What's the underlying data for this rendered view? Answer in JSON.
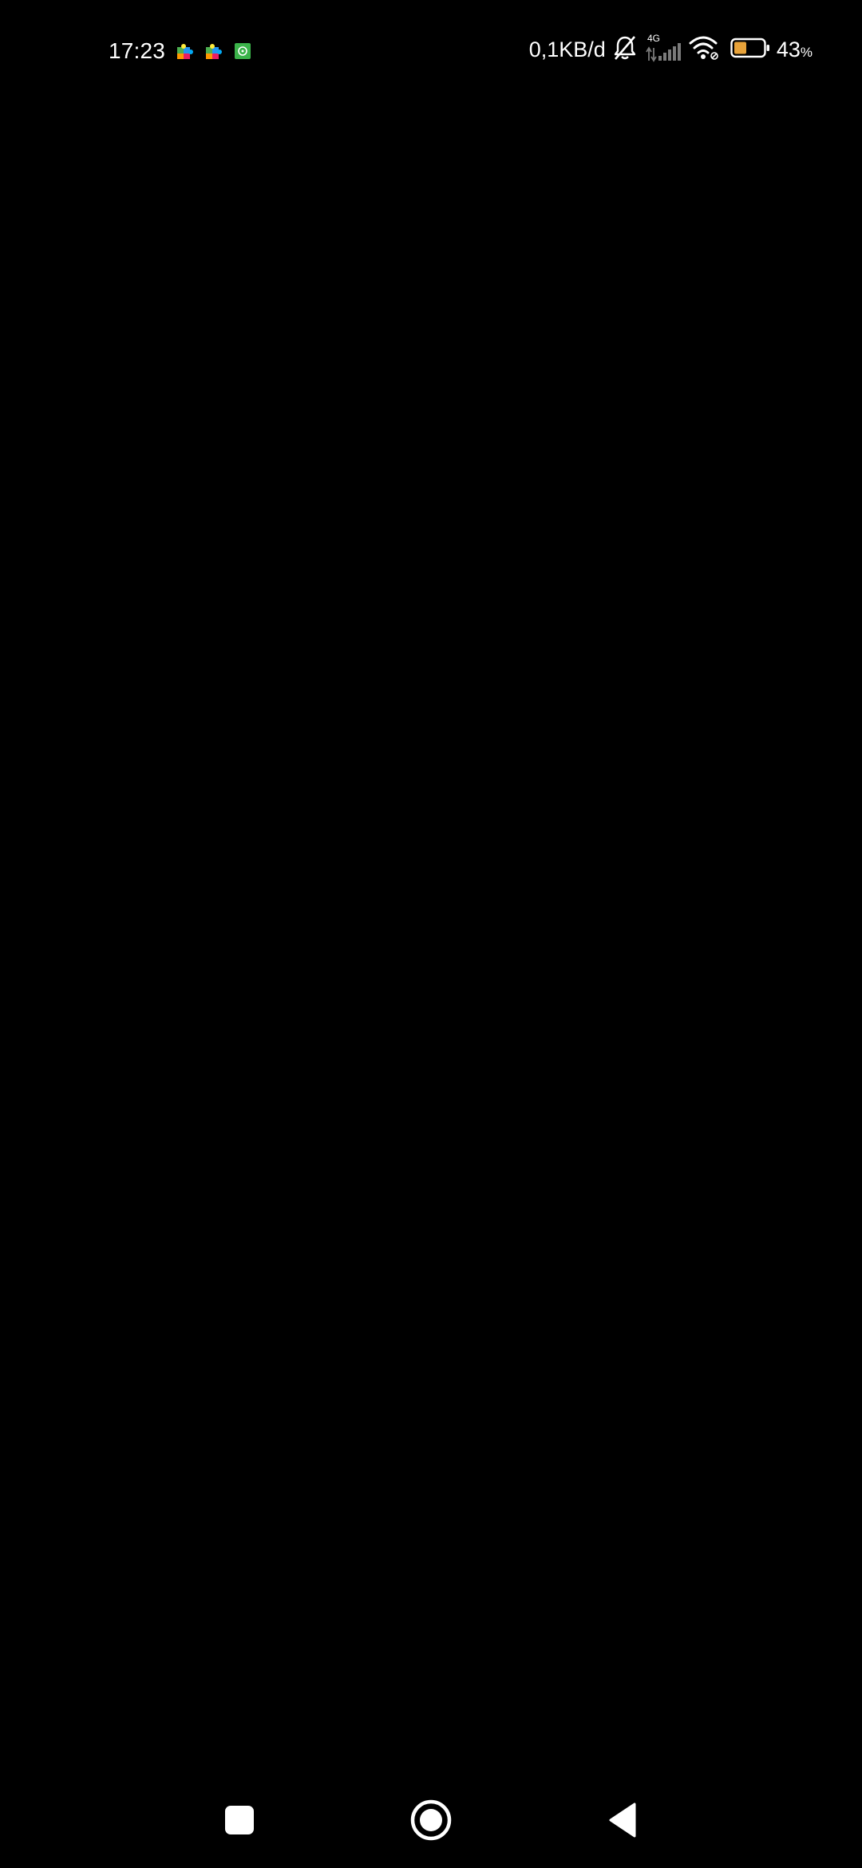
{
  "status_bar": {
    "time": "17:23",
    "net_speed": "0,1KB/d",
    "network_type": "4G",
    "battery_percent": "43",
    "battery_unit": "%",
    "battery_level": 0.43,
    "battery_color": "#e8a33a",
    "notification_icons": [
      "puzzle-app-icon",
      "puzzle-app-icon",
      "green-app-icon"
    ],
    "right_icons": [
      "bell-off-icon",
      "signal-4g-icon",
      "wifi-icon",
      "battery-icon"
    ]
  },
  "nav_bar": {
    "buttons": [
      "recents-button",
      "home-button",
      "back-button"
    ]
  },
  "colors": {
    "background": "#000000",
    "foreground": "#ffffff",
    "green_icon": "#3bb34a"
  }
}
